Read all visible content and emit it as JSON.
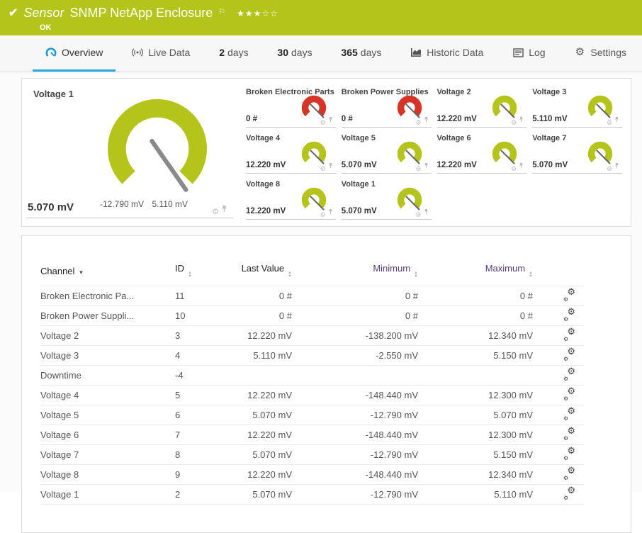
{
  "header": {
    "status_icon": "check",
    "title_prefix": "Sensor",
    "title": "SNMP NetApp Enclosure",
    "status": "OK",
    "stars_filled": 3,
    "stars_total": 5
  },
  "colors": {
    "ok_green": "#b5c41b",
    "alarm_red": "#d63426",
    "accent_blue": "#29a9e1"
  },
  "tabs": [
    {
      "label": "Overview",
      "icon": "gauge-icon",
      "active": true
    },
    {
      "label": "Live Data",
      "icon": "live-data-icon"
    },
    {
      "bold": "2",
      "label": "days"
    },
    {
      "bold": "30",
      "label": "days"
    },
    {
      "bold": "365",
      "label": "days"
    },
    {
      "label": "Historic Data",
      "icon": "chart-icon"
    },
    {
      "label": "Log",
      "icon": "log-icon"
    },
    {
      "label": "Settings",
      "icon": "gear-icon"
    }
  ],
  "gauges": {
    "main": {
      "label": "Voltage 1",
      "value": "5.070 mV",
      "min_label": "-12.790 mV",
      "max_label": "5.110 mV",
      "color": "#b5c41b",
      "needle_deg": 55
    },
    "small": [
      {
        "label": "Broken Electronic Parts",
        "value": "0 #",
        "color": "#d63426",
        "needle_deg": 45
      },
      {
        "label": "Broken Power Supplies",
        "value": "0 #",
        "color": "#d63426",
        "needle_deg": 45
      },
      {
        "label": "Voltage 2",
        "value": "12.220 mV",
        "color": "#b5c41b",
        "needle_deg": 45
      },
      {
        "label": "Voltage 3",
        "value": "5.110 mV",
        "color": "#b5c41b",
        "needle_deg": 45
      },
      {
        "label": "Voltage 4",
        "value": "12.220 mV",
        "color": "#b5c41b",
        "needle_deg": 45
      },
      {
        "label": "Voltage 5",
        "value": "5.070 mV",
        "color": "#b5c41b",
        "needle_deg": 45
      },
      {
        "label": "Voltage 6",
        "value": "12.220 mV",
        "color": "#b5c41b",
        "needle_deg": 45
      },
      {
        "label": "Voltage 7",
        "value": "5.070 mV",
        "color": "#b5c41b",
        "needle_deg": 45
      },
      {
        "label": "Voltage 8",
        "value": "12.220 mV",
        "color": "#b5c41b",
        "needle_deg": 45
      },
      {
        "label": "Voltage 1",
        "value": "5.070 mV",
        "color": "#b5c41b",
        "needle_deg": 45
      }
    ]
  },
  "table": {
    "columns": [
      {
        "label": "Channel",
        "sort": "active-desc"
      },
      {
        "label": "ID",
        "sort": "both"
      },
      {
        "label": "Last Value",
        "sort": "both",
        "align": "right"
      },
      {
        "label": "Minimum",
        "sort": "both",
        "align": "right",
        "visited": true
      },
      {
        "label": "Maximum",
        "sort": "both",
        "align": "right",
        "visited": true
      }
    ],
    "rows": [
      {
        "channel": "Broken Electronic Pa...",
        "id": "11",
        "last": "0 #",
        "min": "0 #",
        "max": "0 #"
      },
      {
        "channel": "Broken Power Suppli...",
        "id": "10",
        "last": "0 #",
        "min": "0 #",
        "max": "0 #"
      },
      {
        "channel": "Voltage 2",
        "id": "3",
        "last": "12.220 mV",
        "min": "-138.200 mV",
        "max": "12.340 mV"
      },
      {
        "channel": "Voltage 3",
        "id": "4",
        "last": "5.110 mV",
        "min": "-2.550 mV",
        "max": "5.150 mV"
      },
      {
        "channel": "Downtime",
        "id": "-4",
        "last": "",
        "min": "",
        "max": ""
      },
      {
        "channel": "Voltage 4",
        "id": "5",
        "last": "12.220 mV",
        "min": "-148.440 mV",
        "max": "12.300 mV"
      },
      {
        "channel": "Voltage 5",
        "id": "6",
        "last": "5.070 mV",
        "min": "-12.790 mV",
        "max": "5.070 mV"
      },
      {
        "channel": "Voltage 6",
        "id": "7",
        "last": "12.220 mV",
        "min": "-148.440 mV",
        "max": "12.300 mV"
      },
      {
        "channel": "Voltage 7",
        "id": "8",
        "last": "5.070 mV",
        "min": "-12.790 mV",
        "max": "5.150 mV"
      },
      {
        "channel": "Voltage 8",
        "id": "9",
        "last": "12.220 mV",
        "min": "-148.440 mV",
        "max": "12.340 mV"
      },
      {
        "channel": "Voltage 1",
        "id": "2",
        "last": "5.070 mV",
        "min": "-12.790 mV",
        "max": "5.110 mV"
      }
    ]
  }
}
